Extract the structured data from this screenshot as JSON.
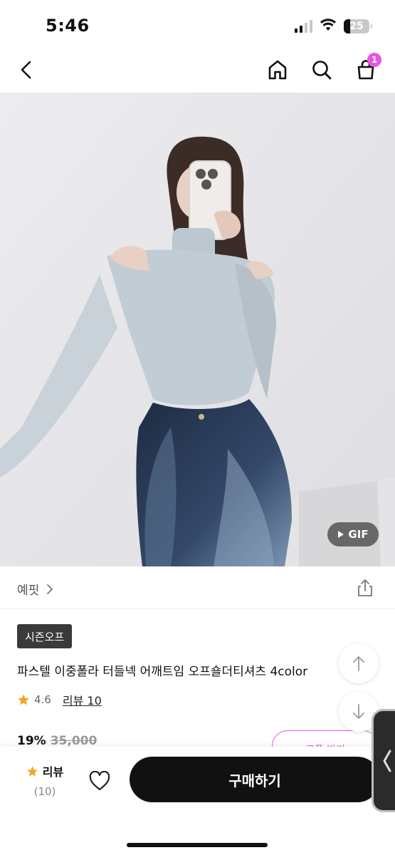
{
  "status_bar": {
    "time": "5:46",
    "battery": "25",
    "battery_level": 0.25,
    "icons": [
      "signal-icon",
      "wifi-icon",
      "battery-icon"
    ]
  },
  "nav": {
    "icons": [
      "back-icon",
      "home-icon",
      "search-icon",
      "cart-icon"
    ],
    "cart_count": "1"
  },
  "product": {
    "gif_label": "GIF",
    "seller": "예핏",
    "tag": "시즌오프",
    "title": "파스텔 이중폴라 터들넥 어깨트임 오프숄더티셔츠 4color",
    "rating": "4.6",
    "review_link": "리뷰 10",
    "discount": "19%",
    "original_price": "35,000",
    "coupon_label": "쿠폰 받기"
  },
  "bottom_bar": {
    "review_label": "리뷰",
    "review_count": "(10)",
    "buy_label": "구매하기"
  },
  "colors": {
    "accent": "#e557e0",
    "star": "#f5a623",
    "buy_button": "#111111"
  }
}
